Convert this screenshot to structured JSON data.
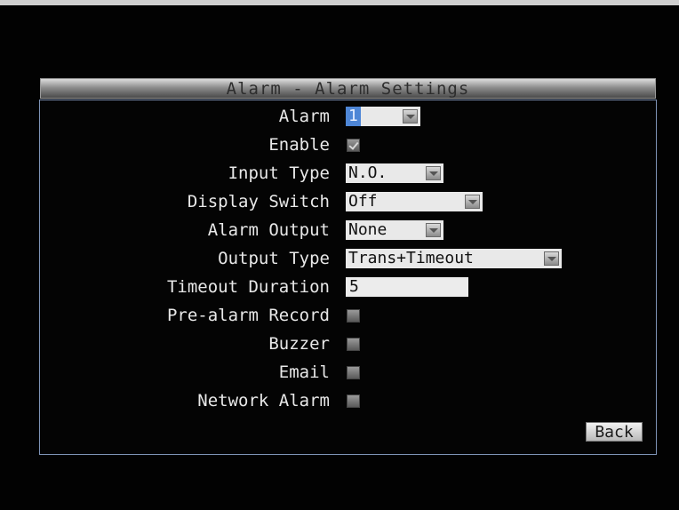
{
  "window": {
    "title": "Alarm - Alarm Settings"
  },
  "fields": {
    "alarm": {
      "label": "Alarm",
      "value": "1"
    },
    "enable": {
      "label": "Enable",
      "checked": true
    },
    "input_type": {
      "label": "Input Type",
      "value": "N.O."
    },
    "display_switch": {
      "label": "Display Switch",
      "value": "Off"
    },
    "alarm_output": {
      "label": "Alarm Output",
      "value": "None"
    },
    "output_type": {
      "label": "Output Type",
      "value": "Trans+Timeout"
    },
    "timeout_duration": {
      "label": "Timeout Duration",
      "value": "5"
    },
    "pre_alarm_record": {
      "label": "Pre-alarm Record",
      "checked": false
    },
    "buzzer": {
      "label": "Buzzer",
      "checked": false
    },
    "email": {
      "label": "Email",
      "checked": false
    },
    "network_alarm": {
      "label": "Network Alarm",
      "checked": false
    }
  },
  "buttons": {
    "back": "Back"
  },
  "icons": {
    "dropdown": "chevron-down-icon",
    "checkbox": "checkbox-icon"
  },
  "colors": {
    "background": "#000000",
    "panel_border": "#7e93b6",
    "selection": "#4e86d6",
    "field_bg": "#e9e9e9"
  }
}
